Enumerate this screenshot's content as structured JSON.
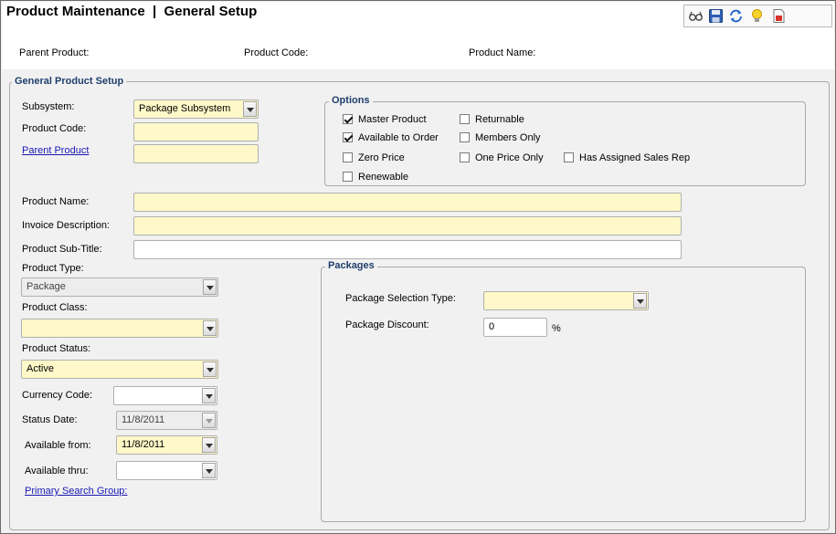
{
  "title": "Product Maintenance  |  General Setup",
  "toolbar": {
    "icons": [
      "glasses-icon",
      "save-icon",
      "refresh-icon",
      "lightbulb-icon",
      "report-icon"
    ]
  },
  "header": {
    "parent_product_label": "Parent Product:",
    "product_code_label": "Product Code:",
    "product_name_label": "Product Name:"
  },
  "general": {
    "title": "General Product Setup",
    "subsystem_label": "Subsystem:",
    "subsystem_value": "Package Subsystem",
    "product_code_label": "Product Code:",
    "product_code_value": "",
    "parent_product_link": "Parent Product",
    "parent_product_value": "",
    "product_name_label": "Product Name:",
    "product_name_value": "",
    "invoice_description_label": "Invoice Description:",
    "invoice_description_value": "",
    "product_subtitle_label": "Product Sub-Title:",
    "product_subtitle_value": "",
    "product_type_label": "Product Type:",
    "product_type_value": "Package",
    "product_class_label": "Product Class:",
    "product_class_value": "",
    "product_status_label": "Product Status:",
    "product_status_value": "Active",
    "currency_code_label": "Currency Code:",
    "currency_code_value": "",
    "status_date_label": "Status Date:",
    "status_date_value": "11/8/2011",
    "available_from_label": "Available from:",
    "available_from_value": "11/8/2011",
    "available_thru_label": "Available thru:",
    "available_thru_value": "",
    "primary_search_group_link": "Primary Search Group:"
  },
  "options": {
    "title": "Options",
    "items": [
      {
        "label": "Master Product",
        "checked": true
      },
      {
        "label": "Returnable",
        "checked": false
      },
      {
        "label": "Available to Order",
        "checked": true
      },
      {
        "label": "Members Only",
        "checked": false
      },
      {
        "label": "Zero Price",
        "checked": false
      },
      {
        "label": "One Price Only",
        "checked": false
      },
      {
        "label": "Has Assigned Sales Rep",
        "checked": false
      },
      {
        "label": "Renewable",
        "checked": false
      }
    ]
  },
  "packages": {
    "title": "Packages",
    "selection_type_label": "Package Selection Type:",
    "selection_type_value": "",
    "discount_label": "Package Discount:",
    "discount_value": "0",
    "discount_unit": "%"
  }
}
